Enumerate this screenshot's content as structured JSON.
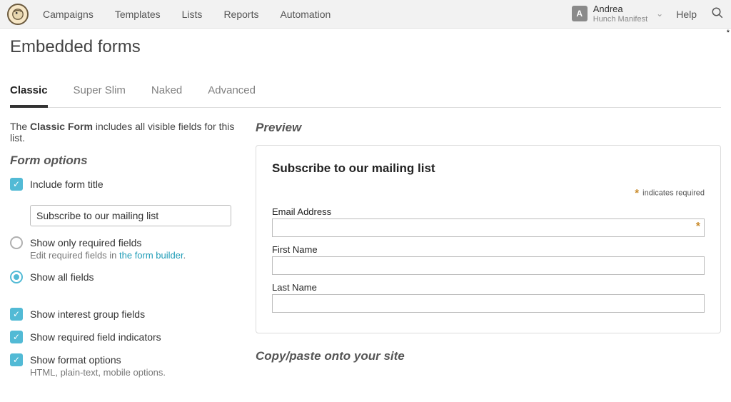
{
  "nav": {
    "items": [
      "Campaigns",
      "Templates",
      "Lists",
      "Reports",
      "Automation"
    ],
    "user": {
      "initial": "A",
      "name": "Andrea",
      "company": "Hunch Manifest"
    },
    "help": "Help"
  },
  "page": {
    "title": "Embedded forms",
    "tabs": [
      "Classic",
      "Super Slim",
      "Naked",
      "Advanced"
    ],
    "intro_prefix": "The ",
    "intro_bold": "Classic Form",
    "intro_suffix": " includes all visible fields for this list."
  },
  "form_options": {
    "heading": "Form options",
    "include_title": {
      "label": "Include form title",
      "value": "Subscribe to our mailing list"
    },
    "show_required_only": {
      "label": "Show only required fields",
      "sub_prefix": "Edit required fields in ",
      "sub_link": "the form builder",
      "sub_suffix": "."
    },
    "show_all": {
      "label": "Show all fields"
    },
    "interest_groups": {
      "label": "Show interest group fields"
    },
    "required_indicators": {
      "label": "Show required field indicators"
    },
    "format_options": {
      "label": "Show format options",
      "sub": "HTML, plain-text, mobile options."
    }
  },
  "preview": {
    "heading": "Preview",
    "form_title": "Subscribe to our mailing list",
    "required_note": "indicates required",
    "fields": {
      "email": "Email Address",
      "first": "First Name",
      "last": "Last Name"
    }
  },
  "copy_section": {
    "heading": "Copy/paste onto your site"
  }
}
